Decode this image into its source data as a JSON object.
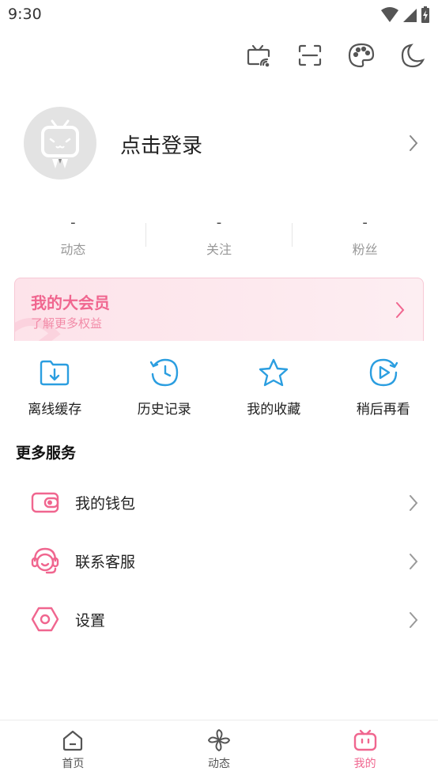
{
  "status_bar": {
    "time": "9:30"
  },
  "top_actions": [
    "tv-cast-icon",
    "scan-icon",
    "palette-icon",
    "moon-icon"
  ],
  "profile": {
    "login_text": "点击登录"
  },
  "stats": [
    {
      "value": "-",
      "label": "动态"
    },
    {
      "value": "-",
      "label": "关注"
    },
    {
      "value": "-",
      "label": "粉丝"
    }
  ],
  "vip": {
    "title": "我的大会员",
    "subtitle": "了解更多权益"
  },
  "quick_actions": [
    {
      "label": "离线缓存",
      "icon": "download-folder-icon"
    },
    {
      "label": "历史记录",
      "icon": "history-clock-icon"
    },
    {
      "label": "我的收藏",
      "icon": "star-icon"
    },
    {
      "label": "稍后再看",
      "icon": "watch-later-icon"
    }
  ],
  "more_services": {
    "title": "更多服务",
    "items": [
      {
        "label": "我的钱包",
        "icon": "wallet-icon"
      },
      {
        "label": "联系客服",
        "icon": "headset-icon"
      },
      {
        "label": "设置",
        "icon": "settings-icon"
      }
    ]
  },
  "bottom_nav": [
    {
      "label": "首页",
      "icon": "home-icon",
      "active": false
    },
    {
      "label": "动态",
      "icon": "pinwheel-icon",
      "active": false
    },
    {
      "label": "我的",
      "icon": "tv-mine-icon",
      "active": true
    }
  ],
  "colors": {
    "accent": "#f0668f",
    "icon_blue": "#2b9ee0",
    "text": "#222222",
    "muted": "#999999"
  }
}
